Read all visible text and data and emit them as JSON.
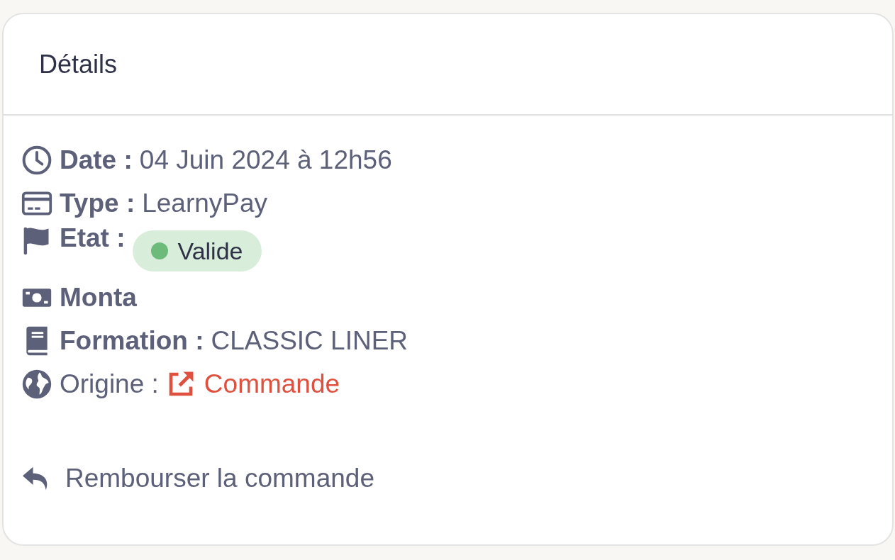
{
  "card": {
    "title": "Détails"
  },
  "rows": [
    {
      "kind": "text",
      "label": "Date :",
      "bold_label": true,
      "value": "04 Juin 2024 à 12h56"
    },
    {
      "kind": "text",
      "label": "Type :",
      "bold_label": true,
      "value": "LearnyPay"
    },
    {
      "kind": "badge",
      "label": "Etat :",
      "bold_label": true,
      "value": "Valide",
      "color": "#6dbb7a"
    },
    {
      "kind": "label_only",
      "label": "Monta",
      "bold_label": true
    },
    {
      "kind": "text",
      "label": "Formation :",
      "bold_label": true,
      "value": "CLASSIC LINER"
    },
    {
      "kind": "link",
      "label": "Origine :",
      "bold_label": false,
      "value": "Commande"
    }
  ],
  "action": {
    "label": "Rembourser la commande"
  }
}
